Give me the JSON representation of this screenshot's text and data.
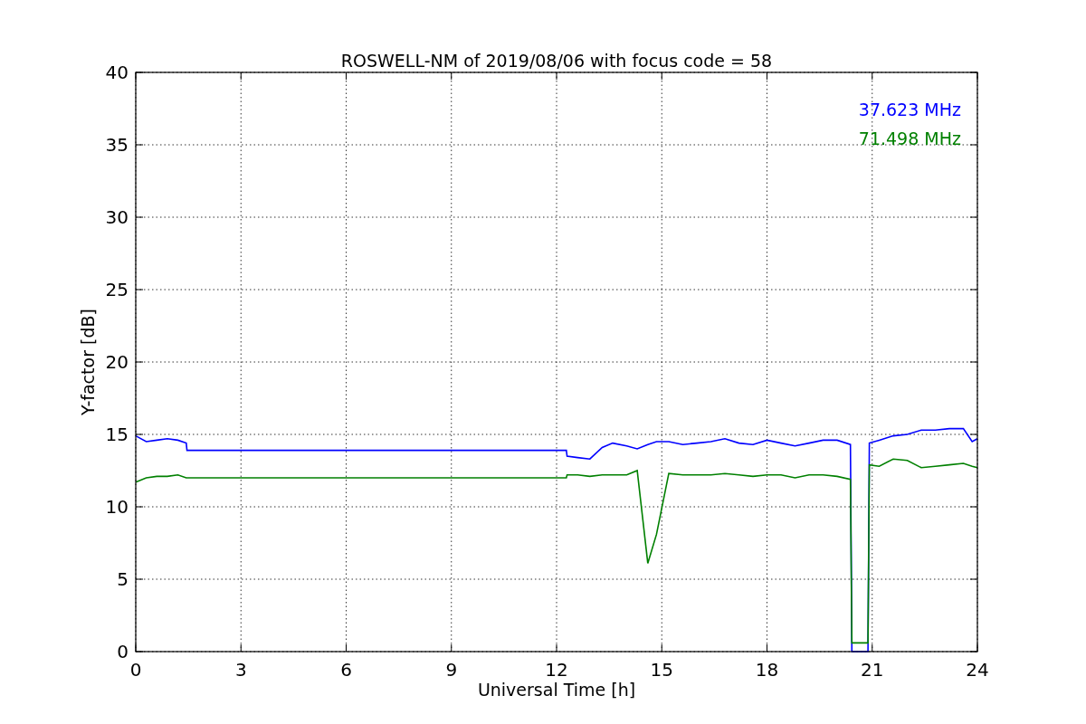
{
  "figure": {
    "chart_data": {
      "type": "line",
      "title": "ROSWELL-NM of 2019/08/06 with focus code = 58",
      "xlabel": "Universal Time [h]",
      "ylabel": "Y-factor [dB]",
      "x": [
        0,
        0.3,
        0.6,
        0.9,
        1.2,
        1.44,
        1.46,
        3,
        6,
        9,
        12.28,
        12.3,
        12.6,
        12.95,
        13.3,
        13.6,
        14,
        14.3,
        14.6,
        14.85,
        15.2,
        15.6,
        16,
        16.4,
        16.8,
        17.2,
        17.6,
        18,
        18.4,
        18.8,
        19.2,
        19.6,
        20,
        20.38,
        20.42,
        20.88,
        20.92,
        21.2,
        21.6,
        22,
        22.4,
        22.8,
        23.2,
        23.6,
        23.85,
        24
      ],
      "series": [
        {
          "name": "37.623 MHz",
          "color": "#0000ff",
          "values": [
            14.9,
            14.5,
            14.6,
            14.7,
            14.6,
            14.4,
            13.9,
            13.9,
            13.9,
            13.9,
            13.9,
            13.5,
            13.4,
            13.3,
            14.1,
            14.4,
            14.2,
            14.0,
            14.3,
            14.5,
            14.5,
            14.3,
            14.4,
            14.5,
            14.7,
            14.4,
            14.3,
            14.6,
            14.4,
            14.2,
            14.4,
            14.6,
            14.6,
            14.3,
            0,
            0,
            14.4,
            14.6,
            14.9,
            15.0,
            15.3,
            15.3,
            15.4,
            15.4,
            14.5,
            14.7
          ]
        },
        {
          "name": "71.498 MHz",
          "color": "#008000",
          "values": [
            11.7,
            12.0,
            12.1,
            12.1,
            12.2,
            12.0,
            12.0,
            12.0,
            12.0,
            12.0,
            12.0,
            12.2,
            12.2,
            12.1,
            12.2,
            12.2,
            12.2,
            12.5,
            6.1,
            8.1,
            12.3,
            12.2,
            12.2,
            12.2,
            12.3,
            12.2,
            12.1,
            12.2,
            12.2,
            12.0,
            12.2,
            12.2,
            12.1,
            11.9,
            0.6,
            0.6,
            12.9,
            12.8,
            13.3,
            13.2,
            12.7,
            12.8,
            12.9,
            13.0,
            12.8,
            12.7
          ]
        }
      ],
      "grid": true,
      "xlim": [
        0,
        24
      ],
      "ylim": [
        0,
        40
      ],
      "xticks": [
        0,
        3,
        6,
        9,
        12,
        15,
        18,
        21,
        24
      ],
      "yticks": [
        0,
        5,
        10,
        15,
        20,
        25,
        30,
        35,
        40
      ]
    }
  }
}
